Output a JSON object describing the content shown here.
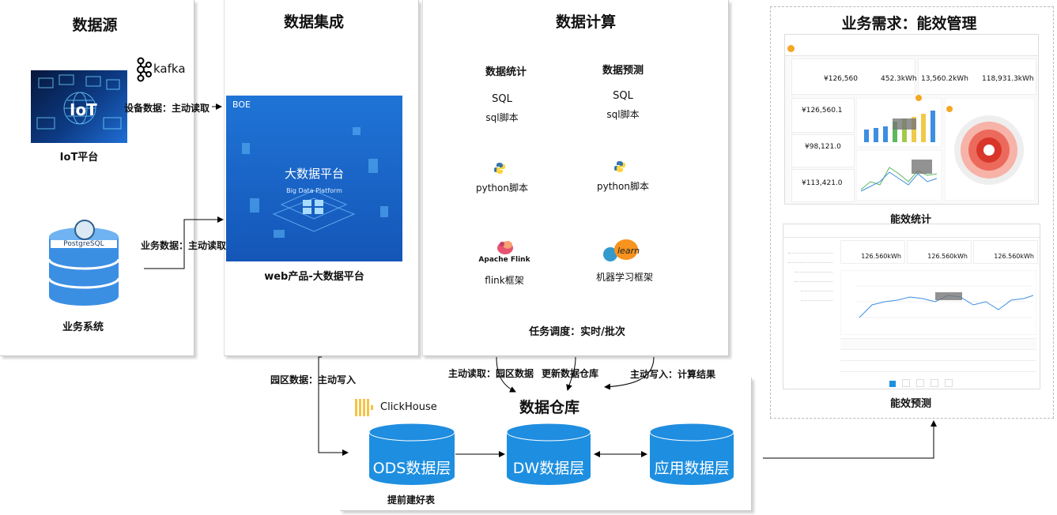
{
  "sections": {
    "source": "数据源",
    "integration": "数据集成",
    "compute": "数据计算",
    "business": "业务需求：能效管理",
    "warehouse": "数据仓库"
  },
  "source": {
    "iot_label": "IoT平台",
    "iot_logo_text": "IoT",
    "kafka_text": "kafka",
    "device_edge": "设备数据：主动读取",
    "postgres_text": "PostgreSQL",
    "business_system": "业务系统",
    "business_edge": "业务数据：主动读取"
  },
  "integration": {
    "brand": "BOE",
    "platform_cn": "大数据平台",
    "platform_en": "Big Data Platform",
    "caption": "web产品-大数据平台",
    "park_edge": "园区数据：主动写入"
  },
  "compute": {
    "stats_title": "数据统计",
    "predict_title": "数据预测",
    "sql": "SQL",
    "sql_script": "sql脚本",
    "python_script": "python脚本",
    "flink_logo": "Apache Flink",
    "flink_framework": "flink框架",
    "learn_logo": "learn",
    "ml_framework": "机器学习框架",
    "scheduling": "任务调度：实时/批次"
  },
  "edges": {
    "read_park": "主动读取：园区数据",
    "update_dw": "更新数据仓库",
    "write_result": "主动写入：计算结果"
  },
  "warehouse": {
    "clickhouse": "ClickHouse",
    "ods": "ODS数据层",
    "dw": "DW数据层",
    "app": "应用数据层",
    "prebuilt": "提前建好表"
  },
  "business": {
    "stats_caption": "能效统计",
    "predict_caption": "能效预测",
    "stat_values": [
      "¥126,560",
      "452.3kWh",
      "13,560.2kWh",
      "118,931.3kWh"
    ],
    "side_values": [
      "¥126,560.1",
      "¥98,121.0",
      "¥113,421.0"
    ],
    "predict_values": [
      "126.560kWh",
      "126.560kWh",
      "126.560kWh"
    ]
  },
  "colors": {
    "cylinder": "#1e8fe0",
    "platform_bg": "#1a6fd1",
    "arrow": "#000000"
  }
}
